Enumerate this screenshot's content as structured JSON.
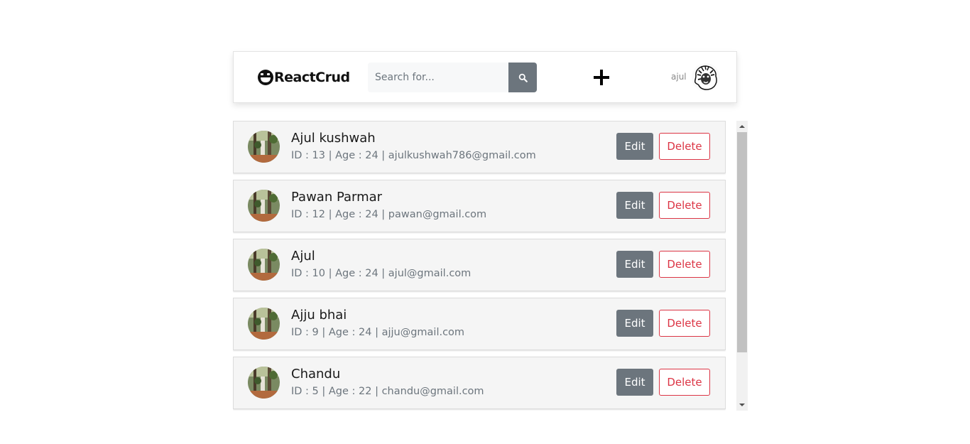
{
  "header": {
    "brand": "ReactCrud",
    "search": {
      "placeholder": "Search for...",
      "value": ""
    },
    "add_icon": "plus-icon",
    "username": "ajul",
    "avatar_icon": "lion-avatar"
  },
  "users": [
    {
      "name": "Ajul kushwah",
      "meta": "ID : 13 | Age : 24 | ajulkushwah786@gmail.com",
      "edit_label": "Edit",
      "delete_label": "Delete"
    },
    {
      "name": "Pawan Parmar",
      "meta": "ID : 12 | Age : 24 | pawan@gmail.com",
      "edit_label": "Edit",
      "delete_label": "Delete"
    },
    {
      "name": "Ajul",
      "meta": "ID : 10 | Age : 24 | ajul@gmail.com",
      "edit_label": "Edit",
      "delete_label": "Delete"
    },
    {
      "name": "Ajju bhai",
      "meta": "ID : 9 | Age : 24 | ajju@gmail.com",
      "edit_label": "Edit",
      "delete_label": "Delete"
    },
    {
      "name": "Chandu",
      "meta": "ID : 5 | Age : 22 | chandu@gmail.com",
      "edit_label": "Edit",
      "delete_label": "Delete"
    }
  ],
  "colors": {
    "secondary": "#6c757d",
    "danger": "#dc3545",
    "card_bg": "#f5f5f5"
  }
}
